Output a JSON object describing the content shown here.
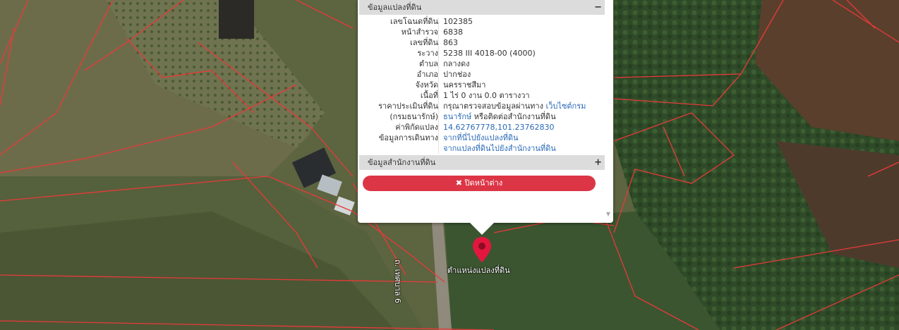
{
  "map": {
    "marker_label": "ตำแหน่งแปลงที่ดิน",
    "road_label": "ถ. เทศบาล 6",
    "parcel_line_color": "#e83a3a"
  },
  "popup": {
    "section1_title": "ข้อมูลแปลงที่ดิน",
    "section1_toggle": "−",
    "section2_title": "ข้อมูลสำนักงานที่ดิน",
    "section2_toggle": "+",
    "close_label": "✖ ปิดหน้าต่าง",
    "rows": [
      {
        "label": "เลขโฉนดที่ดิน",
        "value": "102385"
      },
      {
        "label": "หน้าสำรวจ",
        "value": "6838"
      },
      {
        "label": "เลขที่ดิน",
        "value": "863"
      },
      {
        "label": "ระวาง",
        "value": "5238 III 4018-00 (4000)"
      },
      {
        "label": "ตำบล",
        "value": "กลางดง"
      },
      {
        "label": "อำเภอ",
        "value": "ปากช่อง"
      },
      {
        "label": "จังหวัด",
        "value": "นครราชสีมา"
      },
      {
        "label": "เนื้อที่",
        "value": "1 ไร่ 0 งาน 0.0 ตารางวา"
      }
    ],
    "price": {
      "label1": "ราคาประเมินที่ดิน",
      "label2": "(กรมธนารักษ์)",
      "value_text": "กรุณาตรวจสอบข้อมูลผ่านทาง",
      "link1": "เว็บไซต์กรม",
      "link2": "ธนารักษ์",
      "value_text2": "หรือติดต่อสำนักงานที่ดิน"
    },
    "coords": {
      "label": "ค่าพิกัดแปลง",
      "value": "14.62767778,101.23762830"
    },
    "travel": {
      "label": "ข้อมูลการเดินทาง",
      "link1": "จากที่นี่ไปยังแปลงที่ดิน",
      "link2": "จากแปลงที่ดินไปยังสำนักงานที่ดิน"
    }
  }
}
